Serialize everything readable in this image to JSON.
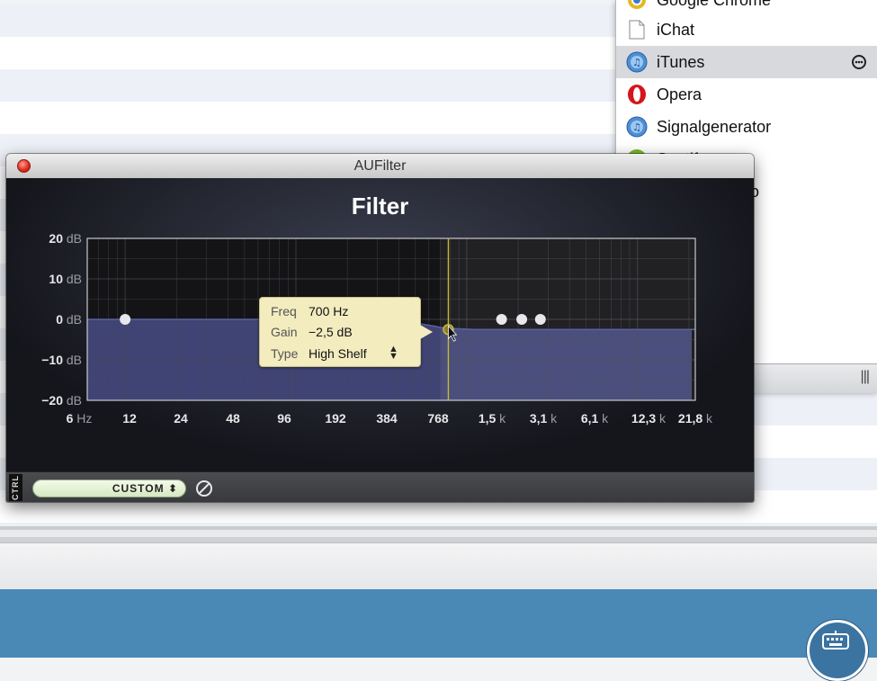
{
  "app_list": {
    "items": [
      {
        "label": "Google Chrome",
        "icon": "chrome-icon"
      },
      {
        "label": "iChat",
        "icon": "document-icon"
      },
      {
        "label": "iTunes",
        "icon": "itunes-icon",
        "selected": true,
        "extra_icon": "remove-circle-icon"
      },
      {
        "label": "Opera",
        "icon": "opera-icon"
      },
      {
        "label": "Signalgenerator",
        "icon": "itunes-icon"
      },
      {
        "label": "Spotify",
        "icon": "spotify-icon"
      },
      {
        "label": "io",
        "icon": ""
      }
    ],
    "footer_glyph": "|||"
  },
  "window": {
    "title": "AUFilter"
  },
  "plugin": {
    "heading": "Filter",
    "preset_value": "CUSTOM ⬍",
    "ctrl_label": "CTRL",
    "tooltip": {
      "freq_label": "Freq",
      "freq_value": "700 Hz",
      "gain_label": "Gain",
      "gain_value": "−2,5 dB",
      "type_label": "Type",
      "type_value": "High Shelf"
    }
  },
  "chart_data": {
    "type": "area",
    "title": "Filter",
    "x_scale": "log",
    "xlim_hz": [
      6,
      21800
    ],
    "ylim_db": [
      -20,
      20
    ],
    "y_ticks": [
      {
        "value": 20,
        "label": "20 dB"
      },
      {
        "value": 10,
        "label": "10 dB"
      },
      {
        "value": 0,
        "label": "0 dB"
      },
      {
        "value": -10,
        "label": "−10 dB"
      },
      {
        "value": -20,
        "label": "−20 dB"
      }
    ],
    "x_ticks": [
      {
        "hz": 6,
        "label": "6",
        "unit": "Hz"
      },
      {
        "hz": 12,
        "label": "12",
        "unit": ""
      },
      {
        "hz": 24,
        "label": "24",
        "unit": ""
      },
      {
        "hz": 48,
        "label": "48",
        "unit": ""
      },
      {
        "hz": 96,
        "label": "96",
        "unit": ""
      },
      {
        "hz": 192,
        "label": "192",
        "unit": ""
      },
      {
        "hz": 384,
        "label": "384",
        "unit": ""
      },
      {
        "hz": 768,
        "label": "768",
        "unit": ""
      },
      {
        "hz": 1500,
        "label": "1,5",
        "unit": "k"
      },
      {
        "hz": 3100,
        "label": "3,1",
        "unit": "k"
      },
      {
        "hz": 6100,
        "label": "6,1",
        "unit": "k"
      },
      {
        "hz": 12300,
        "label": "12,3",
        "unit": "k"
      },
      {
        "hz": 21800,
        "label": "21,8",
        "unit": "k"
      }
    ],
    "response_curve": [
      {
        "hz": 6,
        "db": 0
      },
      {
        "hz": 100,
        "db": 0
      },
      {
        "hz": 300,
        "db": -0.3
      },
      {
        "hz": 500,
        "db": -0.9
      },
      {
        "hz": 650,
        "db": -1.7
      },
      {
        "hz": 700,
        "db": -2.0
      },
      {
        "hz": 850,
        "db": -2.3
      },
      {
        "hz": 1100,
        "db": -2.5
      },
      {
        "hz": 21800,
        "db": -2.5
      }
    ],
    "band_handles": [
      {
        "hz": 10,
        "db": 0,
        "selected": false
      },
      {
        "hz": 700,
        "db": -2.5,
        "selected": true
      },
      {
        "hz": 1600,
        "db": 0,
        "selected": false
      },
      {
        "hz": 2100,
        "db": 0,
        "selected": false
      },
      {
        "hz": 2700,
        "db": 0,
        "selected": false
      }
    ],
    "selected_band": {
      "freq_hz": 700,
      "gain_db": -2.5,
      "type": "High Shelf"
    },
    "colors": {
      "plot_bg": "#141417",
      "fill": "#42477a",
      "grid": "#45464d",
      "marker_line": "#c8b73a",
      "handle": "#e8e8ec"
    },
    "grid": true
  }
}
